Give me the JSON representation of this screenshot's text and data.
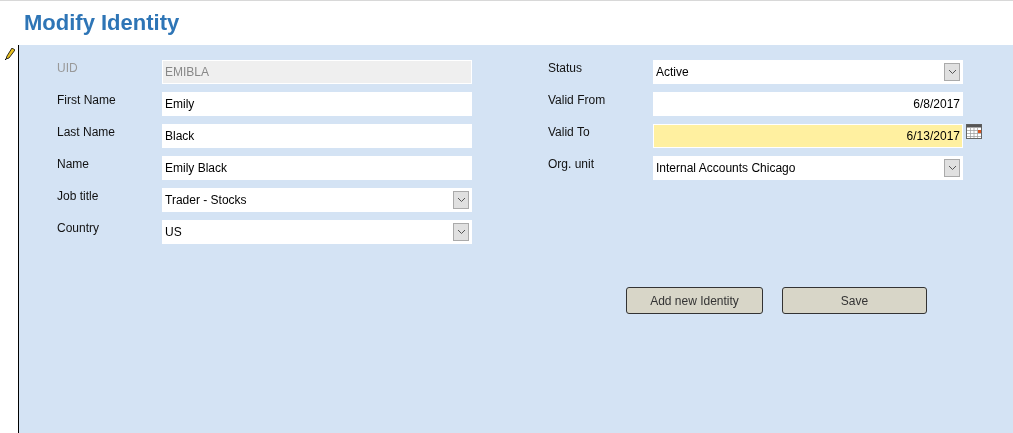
{
  "title": "Modify Identity",
  "left_fields": [
    {
      "label": "UID",
      "value": "EMIBLA",
      "kind": "text",
      "disabled": true
    },
    {
      "label": "First Name",
      "value": "Emily",
      "kind": "text",
      "disabled": false
    },
    {
      "label": "Last Name",
      "value": "Black",
      "kind": "text",
      "disabled": false
    },
    {
      "label": "Name",
      "value": "Emily Black",
      "kind": "text",
      "disabled": false
    },
    {
      "label": "Job title",
      "value": "Trader - Stocks",
      "kind": "dropdown",
      "disabled": false
    },
    {
      "label": "Country",
      "value": "US",
      "kind": "dropdown",
      "disabled": false
    }
  ],
  "right_fields": [
    {
      "label": "Status",
      "value": "Active",
      "kind": "dropdown",
      "focused": false
    },
    {
      "label": "Valid From",
      "value": "6/8/2017",
      "kind": "date",
      "focused": false
    },
    {
      "label": "Valid To",
      "value": "6/13/2017",
      "kind": "date",
      "focused": true
    },
    {
      "label": "Org. unit",
      "value": "Internal Accounts Chicago",
      "kind": "dropdown",
      "focused": false
    }
  ],
  "buttons": [
    "Add new Identity",
    "Save"
  ]
}
